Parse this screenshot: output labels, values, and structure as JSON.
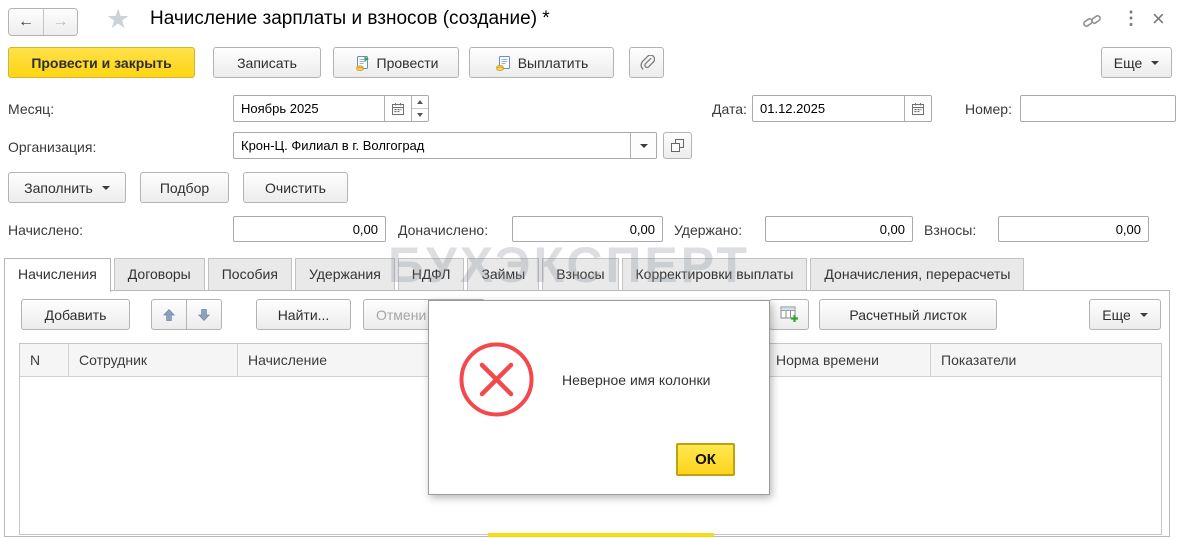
{
  "window": {
    "title": "Начисление зарплаты и взносов (создание) *",
    "back_glyph": "←",
    "forward_glyph": "→",
    "star_glyph": "★",
    "dots_glyph": "⋮",
    "close_glyph": "×"
  },
  "toolbar": {
    "post_and_close": "Провести и закрыть",
    "save": "Записать",
    "post": "Провести",
    "pay": "Выплатить",
    "more": "Еще"
  },
  "fields": {
    "month_label": "Месяц:",
    "month_value": "Ноябрь 2025",
    "date_label": "Дата:",
    "date_value": "01.12.2025",
    "number_label": "Номер:",
    "number_value": "",
    "org_label": "Организация:",
    "org_value": "Крон-Ц. Филиал в г. Волгоград"
  },
  "actions": {
    "fill": "Заполнить",
    "pick": "Подбор",
    "clear": "Очистить"
  },
  "totals": [
    {
      "label": "Начислено:",
      "value": "0,00"
    },
    {
      "label": "Доначислено:",
      "value": "0,00"
    },
    {
      "label": "Удержано:",
      "value": "0,00"
    },
    {
      "label": "Взносы:",
      "value": "0,00"
    }
  ],
  "tabs": [
    {
      "label": "Начисления",
      "active": true
    },
    {
      "label": "Договоры"
    },
    {
      "label": "Пособия"
    },
    {
      "label": "Удержания"
    },
    {
      "label": "НДФЛ"
    },
    {
      "label": "Займы"
    },
    {
      "label": "Взносы"
    },
    {
      "label": "Корректировки выплаты"
    },
    {
      "label": "Доначисления, перерасчеты"
    }
  ],
  "grid_toolbar": {
    "add": "Добавить",
    "find": "Найти...",
    "cancel": "Отмени",
    "payslip": "Расчетный листок",
    "more": "Еще"
  },
  "table": {
    "columns": [
      "N",
      "Сотрудник",
      "Начисление",
      "Норма времени",
      "Показатели"
    ]
  },
  "dialog": {
    "message": "Неверное имя колонки",
    "ok": "ОК"
  },
  "watermark": "БУХЭКСПЕРТ",
  "colors": {
    "accent_yellow": "#FFD91C",
    "error_red": "#F4494C"
  }
}
